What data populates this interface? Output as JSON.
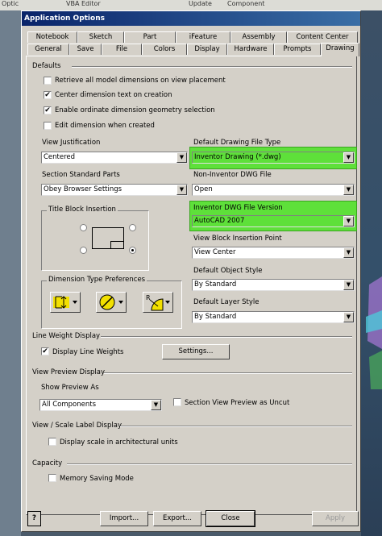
{
  "background": {
    "left_label": "Optic",
    "top_items": [
      "VBA Editor",
      "Update",
      "Component"
    ]
  },
  "dialog": {
    "title": "Application Options",
    "tabs_row1": [
      "Notebook",
      "Sketch",
      "Part",
      "iFeature",
      "Assembly",
      "Content Center"
    ],
    "tabs_row2": [
      "General",
      "Save",
      "File",
      "Colors",
      "Display",
      "Hardware",
      "Prompts",
      "Drawing"
    ],
    "active_tab": "Drawing"
  },
  "defaults": {
    "heading": "Defaults",
    "retrieve_dims": {
      "label": "Retrieve all model dimensions on view placement",
      "checked": false
    },
    "center_text": {
      "label": "Center dimension text on creation",
      "checked": true
    },
    "ordinate_geometry": {
      "label": "Enable ordinate dimension geometry selection",
      "checked": true
    },
    "edit_dim": {
      "label": "Edit dimension when created",
      "checked": false
    },
    "view_justification": {
      "label": "View Justification",
      "value": "Centered"
    },
    "section_std_parts": {
      "label": "Section Standard Parts",
      "value": "Obey Browser Settings"
    },
    "default_drawing_type": {
      "label": "Default Drawing File Type",
      "value": "Inventor Drawing (*.dwg)"
    },
    "non_inventor_dwg": {
      "label": "Non-Inventor DWG File",
      "value": "Open"
    },
    "dwg_version": {
      "label": "Inventor DWG File Version",
      "value": "AutoCAD 2007"
    },
    "view_block_insertion": {
      "label": "View Block Insertion Point",
      "value": "View Center"
    },
    "default_object_style": {
      "label": "Default Object Style",
      "value": "By Standard"
    },
    "default_layer_style": {
      "label": "Default Layer Style",
      "value": "By Standard"
    },
    "title_block": {
      "label": "Title Block Insertion",
      "selected": "bottom-right"
    },
    "dim_type_prefs": {
      "label": "Dimension Type Preferences"
    },
    "highlight_color": "#5ee03a"
  },
  "line_weight": {
    "heading": "Line Weight Display",
    "display_line_weights": {
      "label": "Display Line Weights",
      "checked": true
    },
    "settings_button": "Settings..."
  },
  "view_preview": {
    "heading": "View Preview Display",
    "show_preview_label": "Show Preview As",
    "show_preview_value": "All Components",
    "section_uncut": {
      "label": "Section View Preview as Uncut",
      "checked": false
    }
  },
  "scale_label": {
    "heading": "View / Scale Label Display",
    "arch_units": {
      "label": "Display scale in architectural units",
      "checked": false
    }
  },
  "capacity": {
    "heading": "Capacity",
    "memory_saving": {
      "label": "Memory Saving Mode",
      "checked": false
    }
  },
  "buttons": {
    "help": "?",
    "import": "Import...",
    "export": "Export...",
    "close": "Close",
    "apply": "Apply"
  }
}
